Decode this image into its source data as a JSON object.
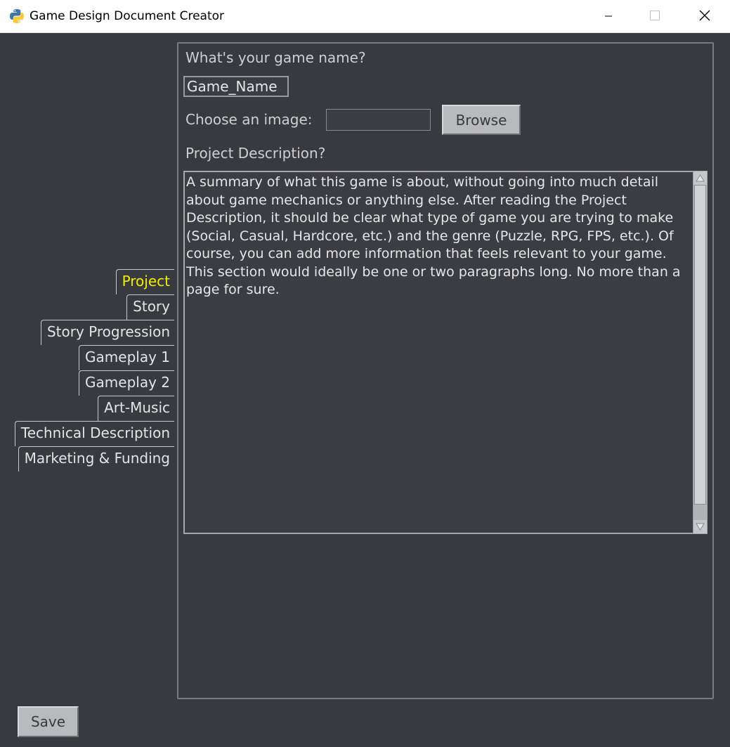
{
  "window": {
    "title": "Game Design Document Creator",
    "controls": [
      "minimize",
      "maximize",
      "close"
    ]
  },
  "tabs": [
    {
      "label": "Project",
      "active": true
    },
    {
      "label": "Story",
      "active": false
    },
    {
      "label": "Story Progression",
      "active": false
    },
    {
      "label": "Gameplay 1",
      "active": false
    },
    {
      "label": "Gameplay 2",
      "active": false
    },
    {
      "label": "Art-Music",
      "active": false
    },
    {
      "label": "Technical Description",
      "active": false
    },
    {
      "label": "Marketing & Funding",
      "active": false
    }
  ],
  "form": {
    "game_name_label": "What's your game name?",
    "game_name_value": "Game_Name",
    "image_label": "Choose an image:",
    "image_value": "",
    "browse_label": "Browse",
    "description_label": "Project Description?",
    "description_text": "A summary of what this game is about, without going into much detail\nabout game mechanics or anything else. After reading the Project\nDescription, it should be clear what type of game you are trying to make\n(Social, Casual, Hardcore, etc.) and the genre (Puzzle, RPG, FPS, etc.). Of\ncourse, you can add more information that feels relevant to your game.\nThis section would ideally be one or two paragraphs long. No more than a\npage for sure."
  },
  "footer": {
    "save_label": "Save"
  },
  "colors": {
    "background": "#383a3f",
    "active_tab_text": "#f0f000",
    "button_face": "#b8babe"
  }
}
